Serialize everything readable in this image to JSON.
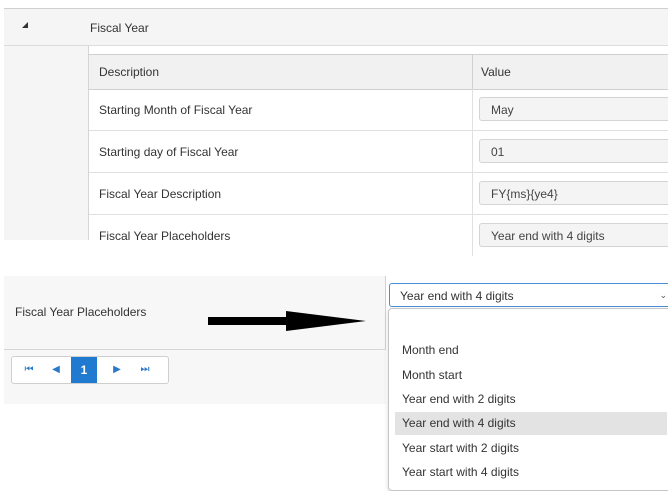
{
  "group": {
    "title": "Fiscal Year"
  },
  "grid": {
    "columns": {
      "description": "Description",
      "value": "Value"
    },
    "rows": [
      {
        "label": "Starting Month of Fiscal Year",
        "value": "May"
      },
      {
        "label": "Starting day of Fiscal Year",
        "value": "01"
      },
      {
        "label": "Fiscal Year Description",
        "value": "FY{ms}{ye4}"
      },
      {
        "label": "Fiscal Year Placeholders",
        "value": "Year end with 4 digits"
      }
    ]
  },
  "zoom": {
    "label": "Fiscal Year Placeholders",
    "select_value": "Year end with 4 digits",
    "options": [
      "Month end",
      "Month start",
      "Year end with 2 digits",
      "Year end with 4 digits",
      "Year start with 2 digits",
      "Year start with 4 digits"
    ],
    "selected_index": 3
  },
  "pager": {
    "first": "⏮",
    "prev": "◀",
    "current": "1",
    "next": "▶",
    "last": "⏭"
  },
  "colors": {
    "accent": "#1f7ad0",
    "select_border": "#4a8dd8"
  }
}
